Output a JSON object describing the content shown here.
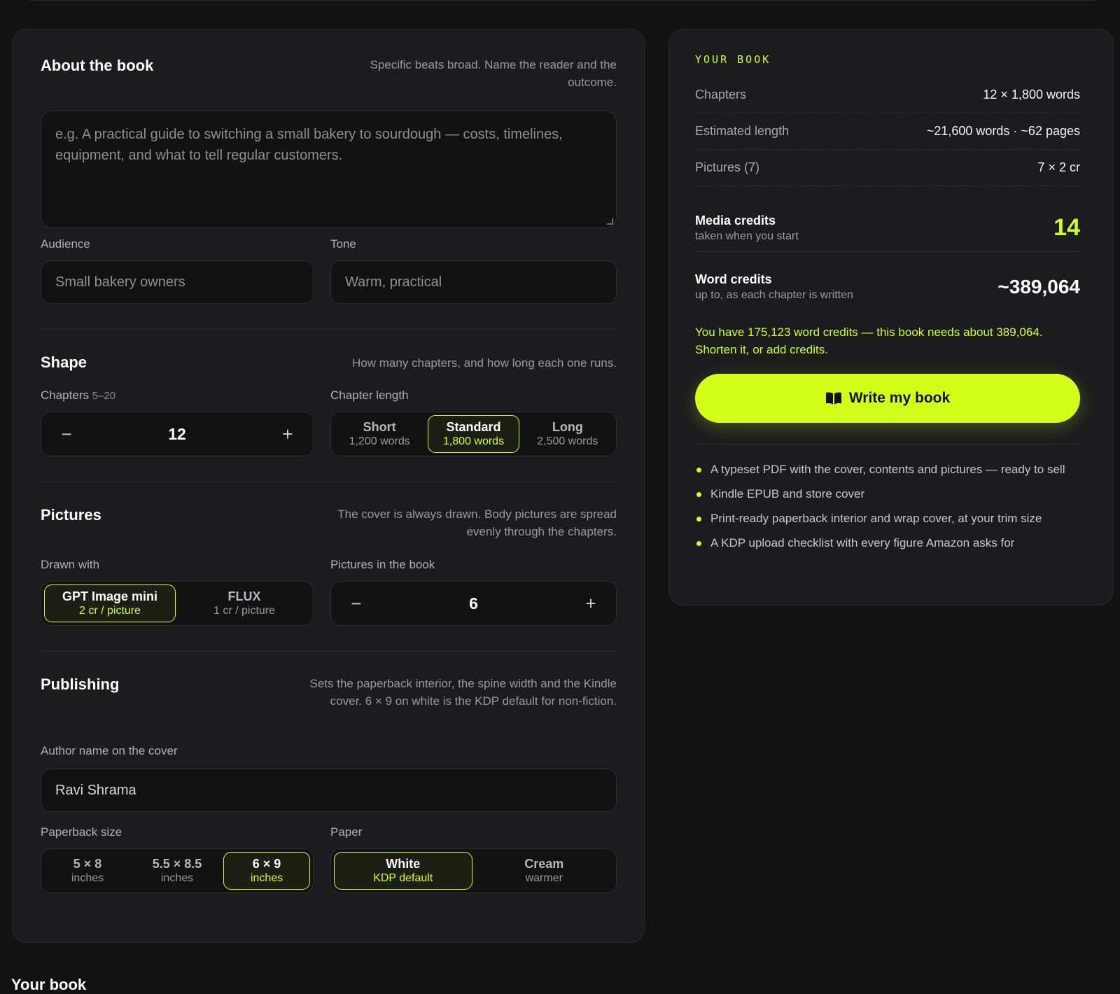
{
  "about": {
    "title": "About the book",
    "hint": "Specific beats broad. Name the reader and the outcome.",
    "placeholder": "e.g. A practical guide to switching a small bakery to sourdough — costs, timelines, equipment, and what to tell regular customers.",
    "audience_label": "Audience",
    "audience_placeholder": "Small bakery owners",
    "tone_label": "Tone",
    "tone_placeholder": "Warm, practical"
  },
  "shape": {
    "title": "Shape",
    "hint": "How many chapters, and how long each one runs.",
    "chapters_label": "Chapters",
    "chapters_range": "5–20",
    "chapters_value": "12",
    "minus": "−",
    "plus": "+",
    "length_label": "Chapter length",
    "length_options": [
      {
        "title": "Short",
        "sub": "1,200 words"
      },
      {
        "title": "Standard",
        "sub": "1,800 words"
      },
      {
        "title": "Long",
        "sub": "2,500 words"
      }
    ],
    "length_selected": "Standard"
  },
  "pictures": {
    "title": "Pictures",
    "hint": "The cover is always drawn. Body pictures are spread evenly through the chapters.",
    "drawn_label": "Drawn with",
    "models": [
      {
        "title": "GPT Image mini",
        "sub": "2 cr / picture"
      },
      {
        "title": "FLUX",
        "sub": "1 cr / picture"
      }
    ],
    "model_selected": "GPT Image mini",
    "count_label": "Pictures in the book",
    "count_value": "6"
  },
  "publishing": {
    "title": "Publishing",
    "hint": "Sets the paperback interior, the spine width and the Kindle cover. 6 × 9 on white is the KDP default for non-fiction.",
    "author_label": "Author name on the cover",
    "author_value": "Ravi Shrama",
    "size_label": "Paperback size",
    "sizes": [
      {
        "title": "5 × 8",
        "sub": "inches"
      },
      {
        "title": "5.5 × 8.5",
        "sub": "inches"
      },
      {
        "title": "6 × 9",
        "sub": "inches"
      }
    ],
    "size_selected": "6 × 9",
    "paper_label": "Paper",
    "papers": [
      {
        "title": "White",
        "sub": "KDP default"
      },
      {
        "title": "Cream",
        "sub": "warmer"
      }
    ],
    "paper_selected": "White"
  },
  "summary": {
    "eyebrow": "YOUR BOOK",
    "rows": [
      {
        "key": "Chapters",
        "value": "12 × 1,800 words"
      },
      {
        "key": "Estimated length",
        "value": "~21,600 words · ~62 pages"
      },
      {
        "key": "Pictures (7)",
        "value": "7 × 2 cr"
      }
    ],
    "media_name": "Media credits",
    "media_sub": "taken when you start",
    "media_value": "14",
    "word_name": "Word credits",
    "word_sub": "up to, as each chapter is written",
    "word_value": "~389,064",
    "warning": "You have 175,123 word credits — this book needs about 389,064. Shorten it, or add credits.",
    "cta_label": "Write my book",
    "bullets": [
      "A typeset PDF with the cover, contents and pictures — ready to sell",
      "Kindle EPUB and store cover",
      "Print-ready paperback interior and wrap cover, at your trim size",
      "A KDP upload checklist with every figure Amazon asks for"
    ]
  },
  "footer_cut": "Your book",
  "colors": {
    "accent": "#d4ff1a",
    "card": "#1c1c1e",
    "bg": "#121212"
  }
}
